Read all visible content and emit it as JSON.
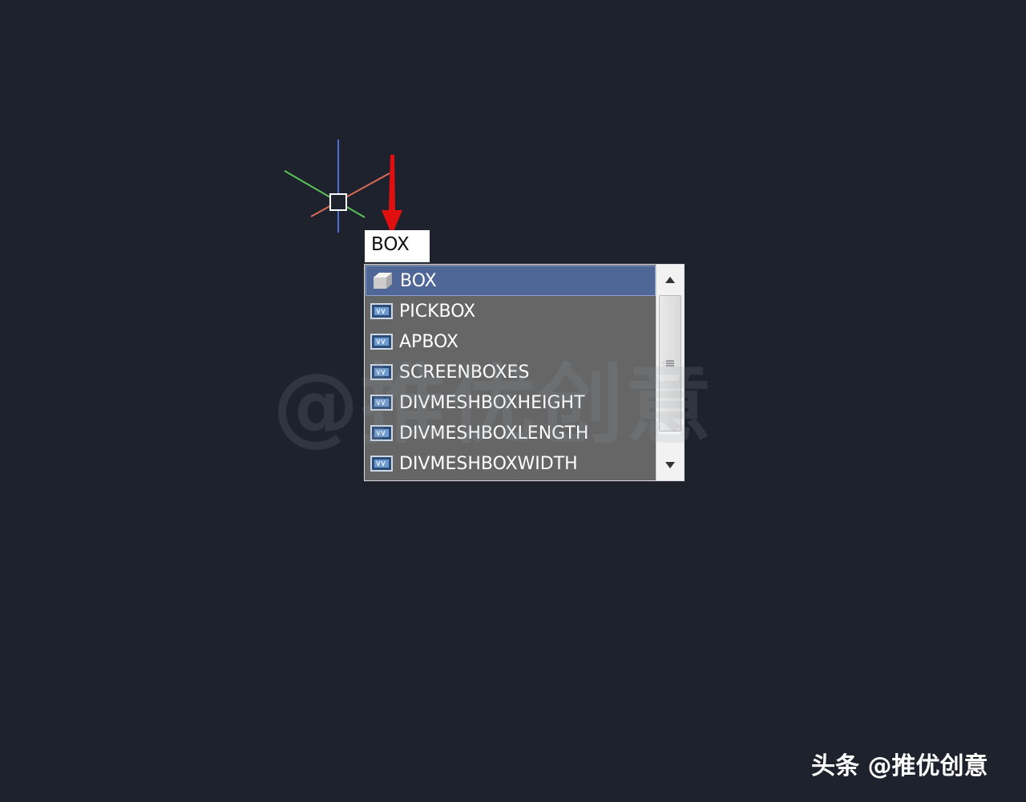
{
  "command_input": {
    "value": "BOX"
  },
  "autocomplete": {
    "selected_index": 0,
    "items": [
      {
        "label": "BOX",
        "icon": "box-3d-icon"
      },
      {
        "label": "PICKBOX",
        "icon": "system-variable-icon"
      },
      {
        "label": "APBOX",
        "icon": "system-variable-icon"
      },
      {
        "label": "SCREENBOXES",
        "icon": "system-variable-icon"
      },
      {
        "label": "DIVMESHBOXHEIGHT",
        "icon": "system-variable-icon"
      },
      {
        "label": "DIVMESHBOXLENGTH",
        "icon": "system-variable-icon"
      },
      {
        "label": "DIVMESHBOXWIDTH",
        "icon": "system-variable-icon"
      }
    ]
  },
  "watermark": {
    "text": "@推优创意"
  },
  "footer": {
    "brand_text": "头条 @推优创意"
  },
  "colors": {
    "canvas_background": "#1e222c",
    "axis_x": "#d86a5a",
    "axis_y": "#4f6fd0",
    "axis_z": "#59c157",
    "annotation_arrow": "#e01010",
    "list_background": "#666666",
    "list_selected": "#4e6796"
  }
}
